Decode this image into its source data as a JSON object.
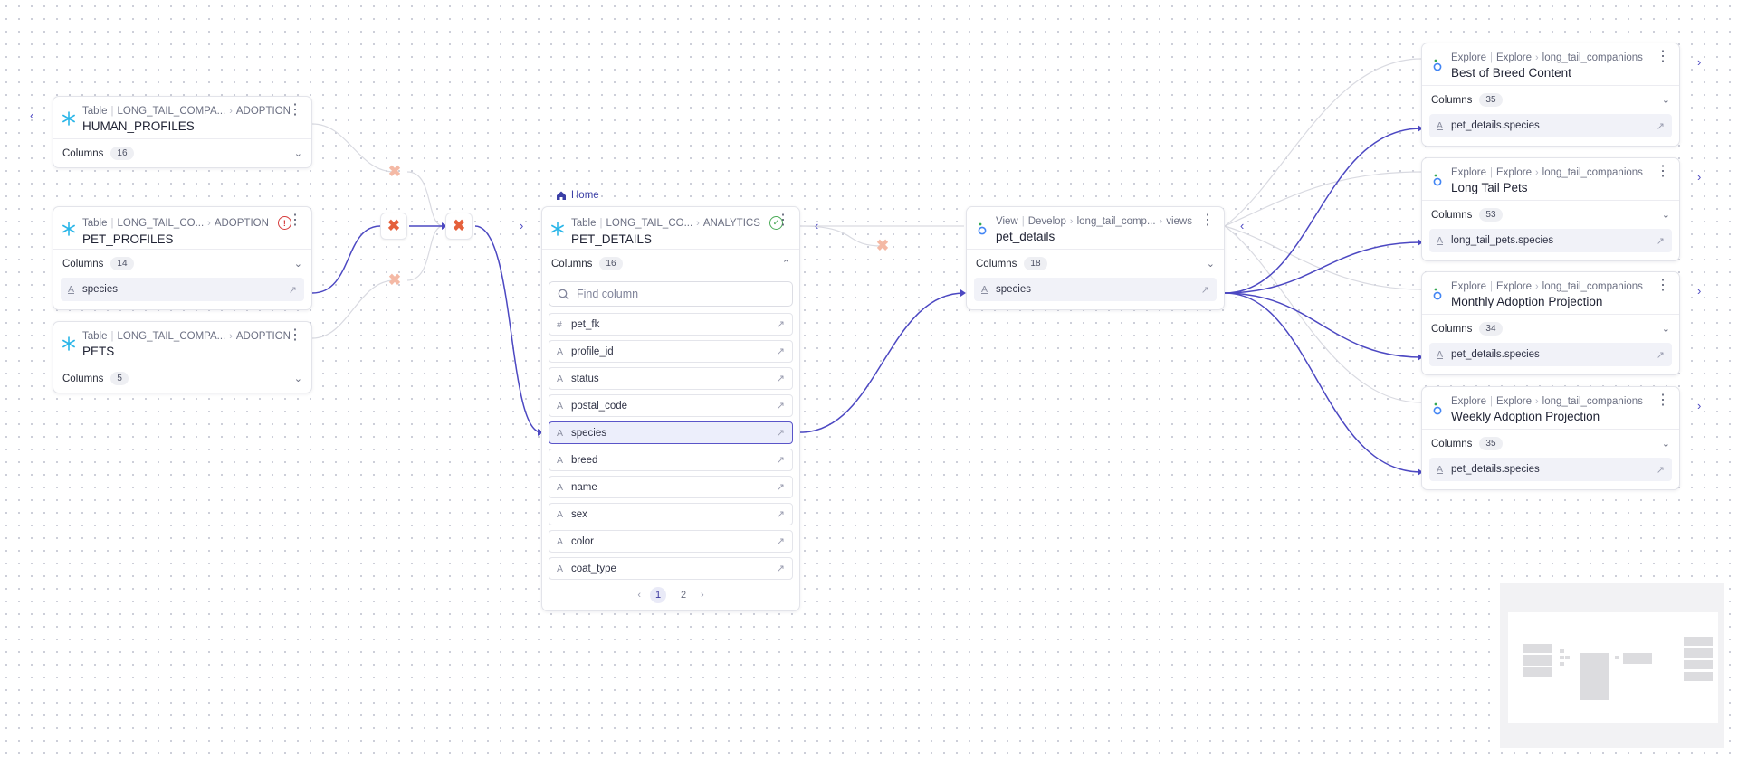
{
  "left_nav": {
    "collapse": "‹"
  },
  "upstream": [
    {
      "id": "human_profiles",
      "kind": "Table",
      "path1": "LONG_TAIL_COMPA...",
      "path2": "ADOPTION",
      "name": "HUMAN_PROFILES",
      "columns_label": "Columns",
      "columns_count": "16",
      "fields": []
    },
    {
      "id": "pet_profiles",
      "kind": "Table",
      "path1": "LONG_TAIL_CO...",
      "path2": "ADOPTION",
      "name": "PET_PROFILES",
      "columns_label": "Columns",
      "columns_count": "14",
      "fields": [
        "species"
      ],
      "status": "error"
    },
    {
      "id": "pets",
      "kind": "Table",
      "path1": "LONG_TAIL_COMPA...",
      "path2": "ADOPTION",
      "name": "PETS",
      "columns_label": "Columns",
      "columns_count": "5",
      "fields": []
    }
  ],
  "focus": {
    "home_label": "Home",
    "kind": "Table",
    "path1": "LONG_TAIL_CO...",
    "path2": "ANALYTICS",
    "name": "PET_DETAILS",
    "columns_label": "Columns",
    "columns_count": "16",
    "search_placeholder": "Find column",
    "columns": [
      {
        "name": "pet_fk",
        "type": "#"
      },
      {
        "name": "profile_id",
        "type": "A"
      },
      {
        "name": "status",
        "type": "A"
      },
      {
        "name": "postal_code",
        "type": "A"
      },
      {
        "name": "species",
        "type": "A",
        "selected": true
      },
      {
        "name": "breed",
        "type": "A"
      },
      {
        "name": "name",
        "type": "A"
      },
      {
        "name": "sex",
        "type": "A"
      },
      {
        "name": "color",
        "type": "A"
      },
      {
        "name": "coat_type",
        "type": "A"
      }
    ],
    "pages": [
      "1",
      "2"
    ],
    "current_page": "1"
  },
  "view": {
    "kind": "View",
    "path1": "Develop",
    "path2": "long_tail_comp...",
    "path3": "views",
    "name": "pet_details",
    "columns_label": "Columns",
    "columns_count": "18",
    "field": "species"
  },
  "explores": [
    {
      "k1": "Explore",
      "k2": "Explore",
      "path": "long_tail_companions",
      "name": "Best of Breed Content",
      "columns_label": "Columns",
      "columns_count": "35",
      "field": "pet_details.species"
    },
    {
      "k1": "Explore",
      "k2": "Explore",
      "path": "long_tail_companions",
      "name": "Long Tail Pets",
      "columns_label": "Columns",
      "columns_count": "53",
      "field": "long_tail_pets.species"
    },
    {
      "k1": "Explore",
      "k2": "Explore",
      "path": "long_tail_companions",
      "name": "Monthly Adoption Projection",
      "columns_label": "Columns",
      "columns_count": "34",
      "field": "pet_details.species"
    },
    {
      "k1": "Explore",
      "k2": "Explore",
      "path": "long_tail_companions",
      "name": "Weekly Adoption Projection",
      "columns_label": "Columns",
      "columns_count": "35",
      "field": "pet_details.species"
    }
  ],
  "colors": {
    "accent": "#4c48c2",
    "edge_faint": "#d7d8df",
    "dbt": "#e5603b",
    "snowflake": "#29b5e8"
  }
}
